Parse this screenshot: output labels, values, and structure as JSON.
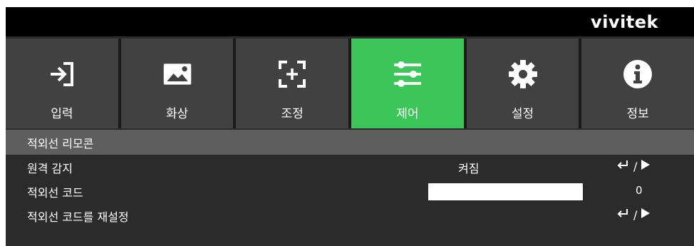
{
  "brand": "vivitek",
  "tabs": [
    {
      "label": "입력",
      "icon": "input-icon"
    },
    {
      "label": "화상",
      "icon": "image-icon"
    },
    {
      "label": "조정",
      "icon": "adjust-icon"
    },
    {
      "label": "제어",
      "icon": "sliders-icon"
    },
    {
      "label": "설정",
      "icon": "gear-icon"
    },
    {
      "label": "정보",
      "icon": "info-icon"
    }
  ],
  "active_tab": "제어",
  "colors": {
    "active": "#3cc65a",
    "tab": "#414141",
    "section": "#5e5e5e",
    "background": "#2b2b2b"
  },
  "section_title": "적외선 리모콘",
  "rows": [
    {
      "name": "원격 감지",
      "value": "켜짐",
      "action_separator": "/"
    },
    {
      "name": "적외선 코드",
      "value": "0"
    },
    {
      "name": "적외선 코드를 재설정",
      "action_separator": "/"
    }
  ]
}
